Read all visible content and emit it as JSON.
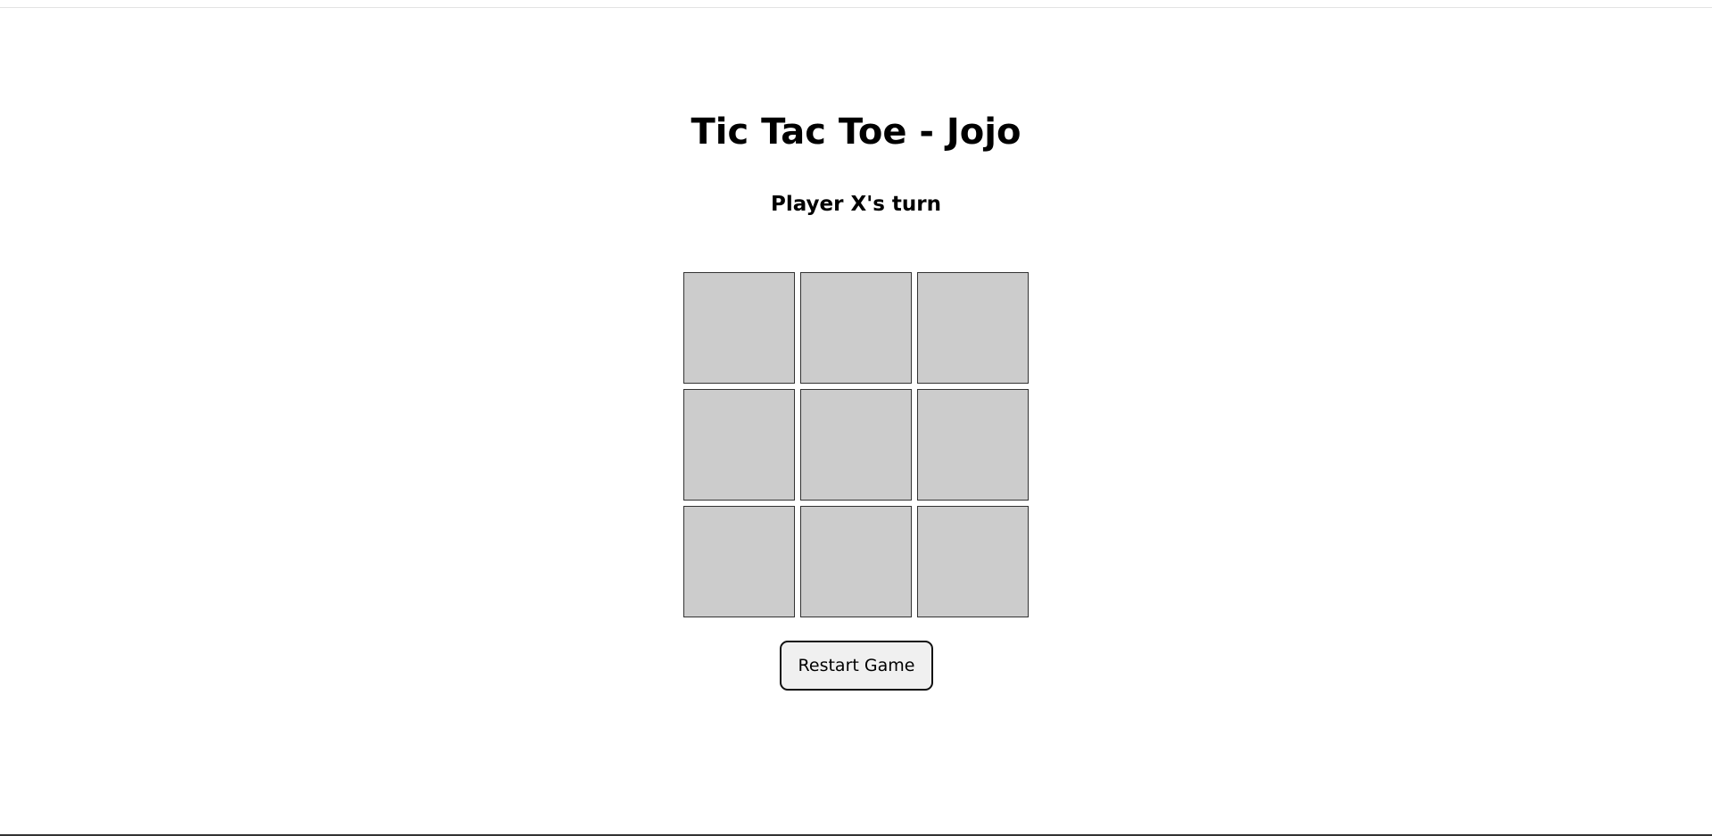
{
  "game": {
    "title": "Tic Tac Toe - Jojo",
    "status": "Player X's turn",
    "current_player": "X",
    "board": [
      [
        "",
        "",
        ""
      ],
      [
        "",
        "",
        ""
      ],
      [
        "",
        "",
        ""
      ]
    ],
    "restart_label": "Restart Game"
  },
  "colors": {
    "cell_background": "#cccccc",
    "cell_border": "#333333",
    "button_background": "#f0f0f0",
    "text": "#000000"
  }
}
